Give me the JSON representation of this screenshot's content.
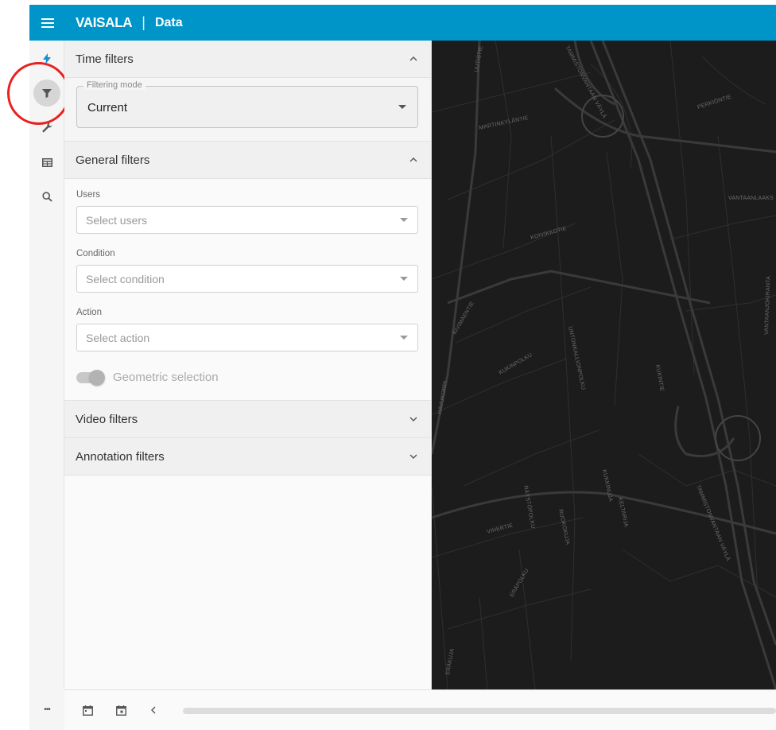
{
  "header": {
    "brand": "VAISALA",
    "separator": "|",
    "title": "Data",
    "color": "#0095c8"
  },
  "rail": {
    "icons": [
      "lightning-icon",
      "filter-icon",
      "wrench-icon",
      "table-icon",
      "search-icon"
    ],
    "active": "filter-icon",
    "more_label": "•••"
  },
  "panel": {
    "time_filters": {
      "title": "Time filters",
      "filtering_mode_label": "Filtering mode",
      "filtering_mode_value": "Current"
    },
    "general_filters": {
      "title": "General filters",
      "users_label": "Users",
      "users_placeholder": "Select users",
      "condition_label": "Condition",
      "condition_placeholder": "Select condition",
      "action_label": "Action",
      "action_placeholder": "Select action",
      "geometric_selection_label": "Geometric selection"
    },
    "video_filters": {
      "title": "Video filters"
    },
    "annotation_filters": {
      "title": "Annotation filters"
    }
  },
  "map": {
    "street_labels": [
      "UUTISTIE",
      "TAMMISTONVANTAAN VÄYLÄ",
      "MARTINKYLÄNTIE",
      "PERKIÖNTIE",
      "VANTAANLAAKS",
      "KOIVIKKOTIE",
      "KIVIMÄENTIE",
      "UNTONKALLIONPOLKU",
      "HAVUKORPI",
      "KUKINPOLKU",
      "RÄYSTÖPOLKU",
      "KUKINTIE",
      "RUOKOKUJA",
      "KELTARIJA",
      "TAMMISTONVANTAAN VÄYLÄ",
      "VANTAANJOKIRANTA",
      "VIHERTIE",
      "ERÄPOLKU",
      "ERÄKUJA",
      "KUKKINUJA"
    ]
  },
  "bottom_bar": {
    "icons": [
      "calendar-start-icon",
      "calendar-end-icon",
      "chevron-left-icon"
    ]
  }
}
